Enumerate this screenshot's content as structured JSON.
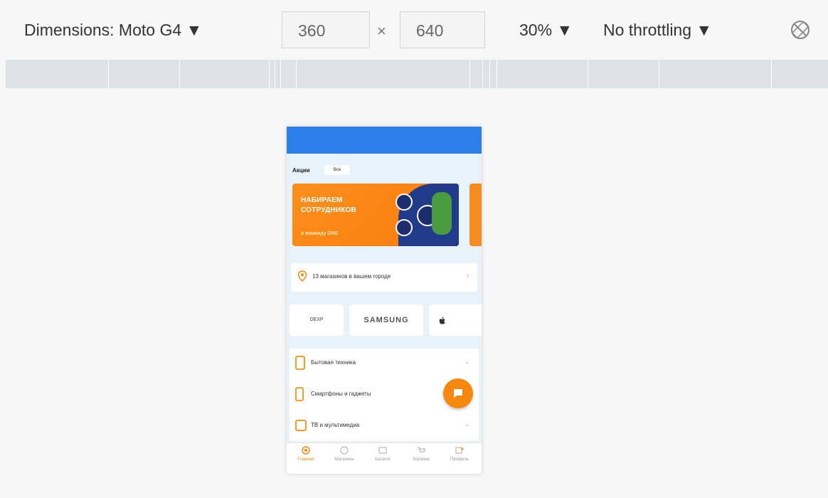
{
  "toolbar": {
    "dimensions_label": "Dimensions: Moto G4 ▼",
    "width_value": "360",
    "times": "×",
    "height_value": "640",
    "zoom": "30% ▼",
    "throttling": "No throttling ▼",
    "rotate_icon": "rotate-icon"
  },
  "device": {
    "promo": {
      "label": "Акции",
      "badge": "Все"
    },
    "banner": {
      "lines": [
        "НАБИРАЕМ",
        "СОТРУДНИКОВ"
      ],
      "sub": "в команду DNS"
    },
    "stores": {
      "text": "13 магазинов в вашем городе",
      "chevron": "›"
    },
    "brands": [
      "DEXP",
      "SAMSUNG",
      " "
    ],
    "categories": [
      {
        "label": "Бытовая техника",
        "chevron": "⌄"
      },
      {
        "label": "Смартфоны и гаджеты",
        "chevron": "⌄"
      },
      {
        "label": "ТВ и мультимедиа",
        "chevron": "⌄"
      }
    ],
    "tabs": [
      {
        "label": "Главная",
        "icon": "home-icon"
      },
      {
        "label": "Магазины",
        "icon": "store-icon"
      },
      {
        "label": "Каталог",
        "icon": "catalog-icon"
      },
      {
        "label": "Корзина",
        "icon": "cart-icon"
      },
      {
        "label": "Профиль",
        "icon": "profile-icon"
      }
    ]
  },
  "colors": {
    "accent": "#f7880f",
    "topbar": "#2d7fe9",
    "background": "#e7f2fb"
  }
}
